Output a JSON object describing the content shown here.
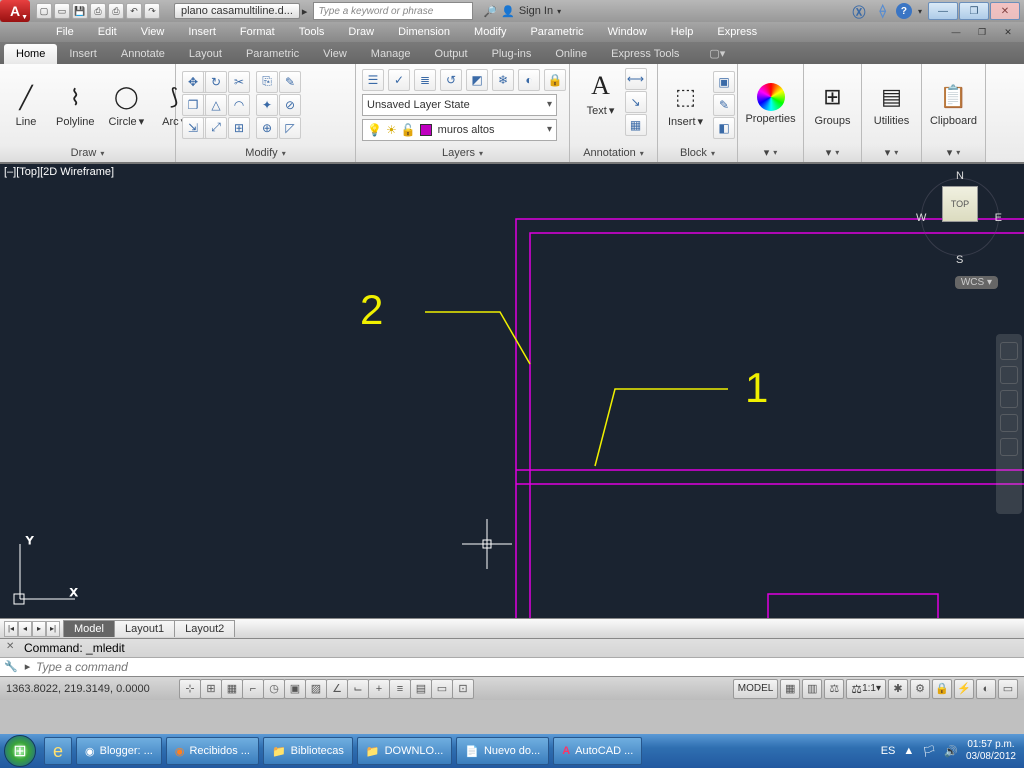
{
  "title": {
    "doc": "plano casamultiline.d...",
    "search_placeholder": "Type a keyword or phrase",
    "signin": "Sign In"
  },
  "mbtns": {
    "min": "—",
    "max": "❐",
    "close": "✕"
  },
  "menu": [
    "File",
    "Edit",
    "View",
    "Insert",
    "Format",
    "Tools",
    "Draw",
    "Dimension",
    "Modify",
    "Parametric",
    "Window",
    "Help",
    "Express"
  ],
  "tabs": [
    "Home",
    "Insert",
    "Annotate",
    "Layout",
    "Parametric",
    "View",
    "Manage",
    "Output",
    "Plug-ins",
    "Online",
    "Express Tools"
  ],
  "active_tab": "Home",
  "draw": {
    "line": "Line",
    "polyline": "Polyline",
    "circle": "Circle",
    "arc": "Arc",
    "panel": "Draw"
  },
  "modify": {
    "panel": "Modify"
  },
  "layers": {
    "state": "Unsaved Layer State",
    "current": "muros altos",
    "panel": "Layers"
  },
  "annotation": {
    "text": "Text",
    "panel": "Annotation"
  },
  "block": {
    "insert": "Insert",
    "panel": "Block"
  },
  "panels_right": {
    "properties": "Properties",
    "groups": "Groups",
    "utilities": "Utilities",
    "clipboard": "Clipboard"
  },
  "canvas": {
    "view_label": "[–][Top][2D Wireframe]",
    "callout1": "1",
    "callout2": "2",
    "cube": "TOP",
    "wcs": "WCS",
    "n": "N",
    "e": "E",
    "s": "S",
    "w": "W"
  },
  "layout_tabs": {
    "model": "Model",
    "l1": "Layout1",
    "l2": "Layout2"
  },
  "cmd": {
    "last": "Command: _mledit",
    "prompt": "Type a command"
  },
  "status": {
    "coords": "1363.8022, 219.3149, 0.0000",
    "model": "MODEL",
    "scale": "1:1"
  },
  "task": {
    "blogger": "Blogger: ...",
    "recib": "Recibidos ...",
    "bibl": "Bibliotecas",
    "down": "DOWNLO...",
    "nuevo": "Nuevo do...",
    "acad": "AutoCAD ...",
    "lang": "ES",
    "time": "01:57 p.m.",
    "date": "03/08/2012"
  }
}
